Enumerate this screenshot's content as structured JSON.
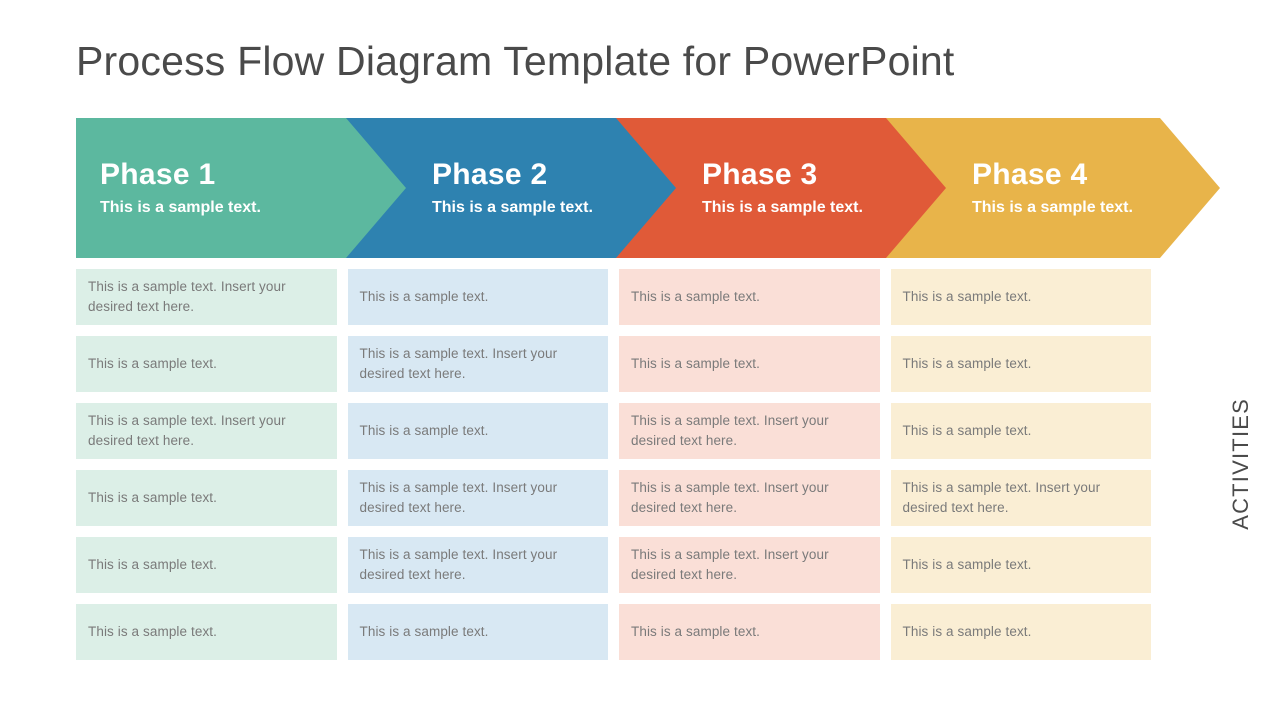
{
  "title": "Process Flow Diagram Template for PowerPoint",
  "side_label": "ACTIVITIES",
  "colors": {
    "phase1": "#5CB89F",
    "phase2": "#2E82B0",
    "phase3": "#E05A38",
    "phase4": "#E8B44A",
    "cell1": "#dcefe7",
    "cell2": "#d8e8f3",
    "cell3": "#fadfd7",
    "cell4": "#faeed4",
    "title_text": "#4a4a4a",
    "cell_text": "#7a7a7a",
    "background": "#ffffff"
  },
  "phases": [
    {
      "title": "Phase 1",
      "subtitle": "This is a sample text."
    },
    {
      "title": "Phase 2",
      "subtitle": "This is a sample text."
    },
    {
      "title": "Phase 3",
      "subtitle": "This is a sample text."
    },
    {
      "title": "Phase 4",
      "subtitle": "This is a sample text."
    }
  ],
  "activities": {
    "col1": [
      "This is a sample text. Insert your desired text here.",
      "This is a sample text.",
      "This is a sample text. Insert your desired text here.",
      "This is a sample text.",
      "This is a sample text.",
      "This is a sample text."
    ],
    "col2": [
      "This is a sample text.",
      "This is a sample text. Insert your desired text here.",
      "This is a sample text.",
      "This is a sample text. Insert your desired text here.",
      "This is a sample text. Insert your desired text here.",
      "This is a sample text."
    ],
    "col3": [
      "This is a sample text.",
      "This is a sample text.",
      "This is a sample text. Insert your desired text here.",
      "This is a sample text. Insert your desired text here.",
      "This is a sample text. Insert your desired text here.",
      "This is a sample text."
    ],
    "col4": [
      "This is a sample text.",
      "This is a sample text.",
      "This is a sample text.",
      "This is a sample text. Insert your desired text here.",
      "This is a sample text.",
      "This is a sample text."
    ]
  }
}
